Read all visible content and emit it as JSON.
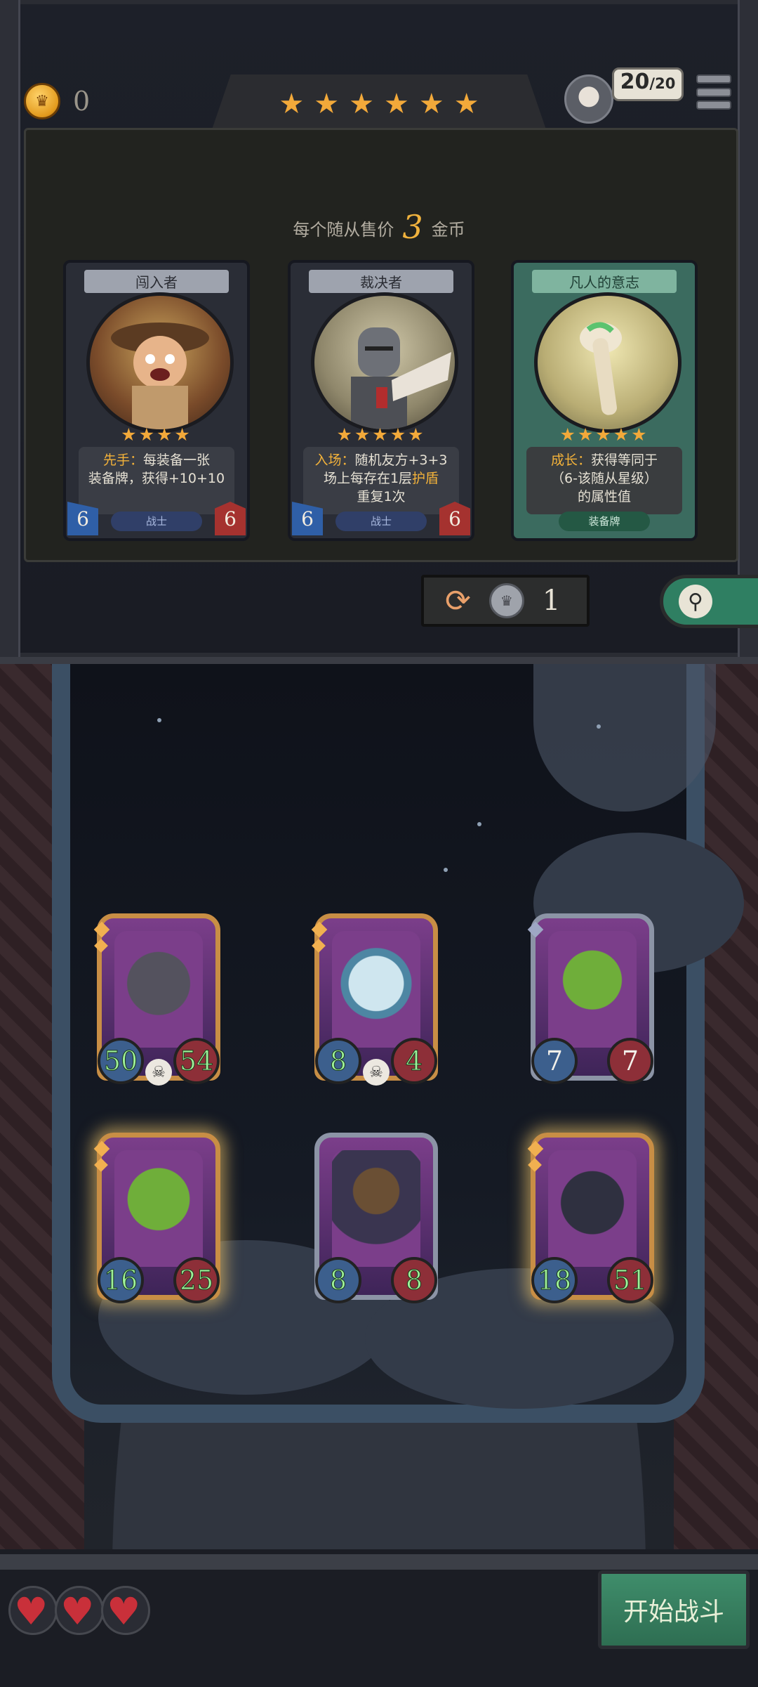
{
  "header": {
    "gold": "0",
    "rank_stars": 6,
    "health_current": "20",
    "health_max": "/20"
  },
  "shop": {
    "price_prefix": "每个随从售价",
    "price_value": "3",
    "price_suffix": "金币",
    "cards": [
      {
        "name": "闯入者",
        "stars": 4,
        "keyword": "先手：",
        "text_1": "每装备一张",
        "text_2": "装备牌，获得+10+10",
        "text_3": "",
        "tag": "战士",
        "attack": "6",
        "health": "6"
      },
      {
        "name": "裁决者",
        "stars": 5,
        "keyword": "入场：",
        "text_1": "随机友方+3+3",
        "text_2_a": "场上每存在1层",
        "text_2_kw": "护盾",
        "text_3": "重复1次",
        "tag": "战士",
        "attack": "6",
        "health": "6"
      },
      {
        "name": "凡人的意志",
        "stars": 5,
        "keyword": "成长：",
        "text_1": "获得等同于",
        "text_2": "（6-该随从星级）",
        "text_3": "的属性值",
        "tag": "装备牌"
      }
    ],
    "refresh_cost": "1"
  },
  "board": {
    "minions": [
      {
        "attack": "50",
        "health": "54"
      },
      {
        "attack": "8",
        "health": "4"
      },
      {
        "attack": "7",
        "health": "7"
      },
      {
        "attack": "16",
        "health": "25"
      },
      {
        "attack": "8",
        "health": "8"
      },
      {
        "attack": "18",
        "health": "51"
      }
    ]
  },
  "footer": {
    "lives": 3,
    "start_label": "开始战斗"
  },
  "colors": {
    "star": "#f2a93a",
    "accent_gold": "#f0b23d",
    "start_green": "#3f8d6b"
  }
}
